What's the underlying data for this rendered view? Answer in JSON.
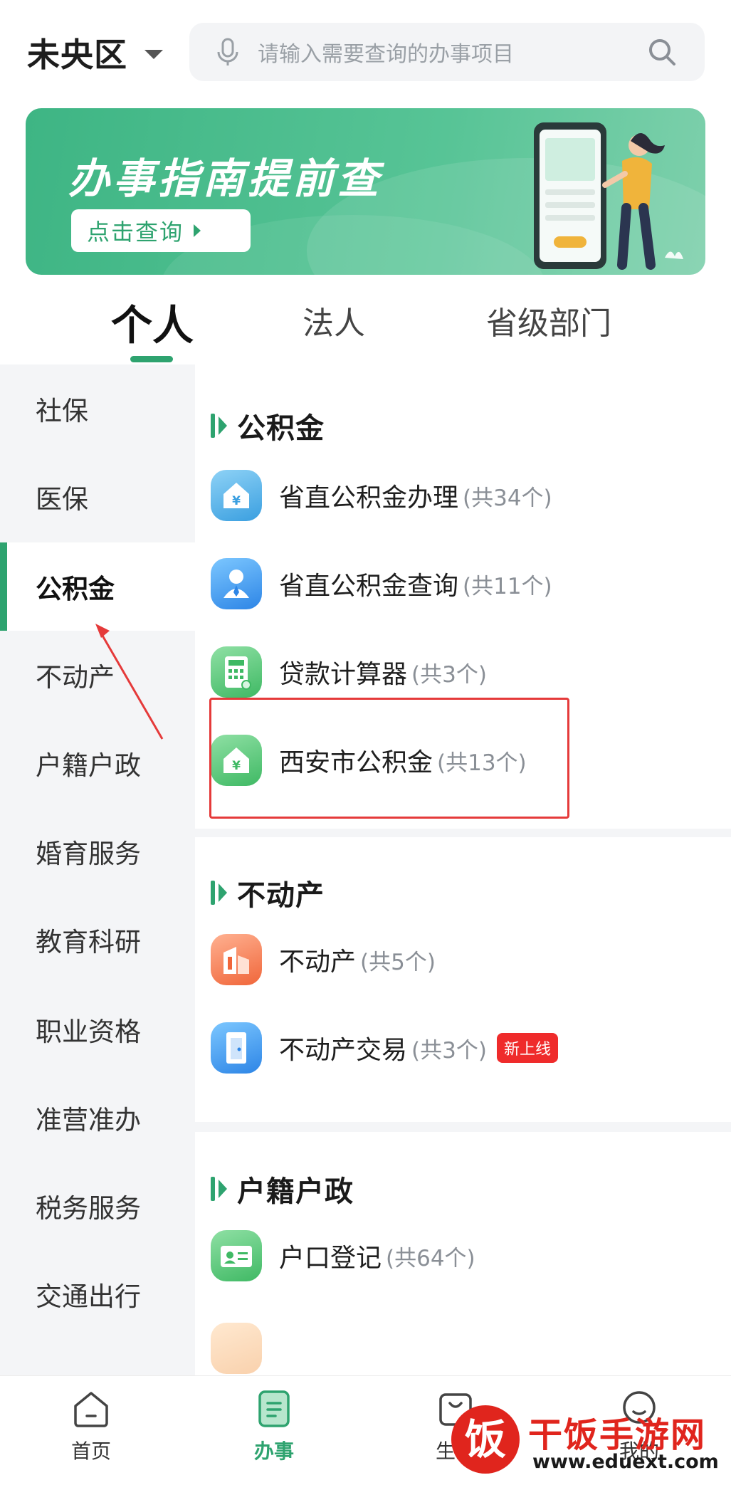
{
  "header": {
    "region": "未央区",
    "search_placeholder": "请输入需要查询的办事项目"
  },
  "banner": {
    "title": "办事指南提前查",
    "button_label": "点击查询"
  },
  "tabs": [
    {
      "label": "个人",
      "active": true
    },
    {
      "label": "法人",
      "active": false
    },
    {
      "label": "省级部门",
      "active": false
    }
  ],
  "sidebar": {
    "items": [
      {
        "label": "社保",
        "active": false
      },
      {
        "label": "医保",
        "active": false
      },
      {
        "label": "公积金",
        "active": true
      },
      {
        "label": "不动产",
        "active": false
      },
      {
        "label": "户籍户政",
        "active": false
      },
      {
        "label": "婚育服务",
        "active": false
      },
      {
        "label": "教育科研",
        "active": false
      },
      {
        "label": "职业资格",
        "active": false
      },
      {
        "label": "准营准办",
        "active": false
      },
      {
        "label": "税务服务",
        "active": false
      },
      {
        "label": "交通出行",
        "active": false
      }
    ]
  },
  "sections": [
    {
      "title": "公积金",
      "items": [
        {
          "name": "省直公积金办理",
          "count": "(共34个)",
          "icon": "house-yuan-icon"
        },
        {
          "name": "省直公积金查询",
          "count": "(共11个)",
          "icon": "person-service-icon"
        },
        {
          "name": "贷款计算器",
          "count": "(共3个)",
          "icon": "calculator-icon"
        },
        {
          "name": "西安市公积金",
          "count": "(共13个)",
          "icon": "house-yuan-icon"
        }
      ]
    },
    {
      "title": "不动产",
      "items": [
        {
          "name": "不动产",
          "count": "(共5个)",
          "icon": "building-icon"
        },
        {
          "name": "不动产交易",
          "count": "(共3个)",
          "icon": "door-icon",
          "badge": "新上线"
        }
      ]
    },
    {
      "title": "户籍户政",
      "items": [
        {
          "name": "户口登记",
          "count": "(共64个)",
          "icon": "id-card-icon"
        }
      ]
    }
  ],
  "bottom_nav": [
    {
      "label": "首页",
      "icon": "home-icon",
      "active": false
    },
    {
      "label": "办事",
      "icon": "document-icon",
      "active": true
    },
    {
      "label": "生活",
      "icon": "shopping-bag-icon",
      "active": false
    },
    {
      "label": "我的",
      "icon": "chat-bubble-icon",
      "active": false
    }
  ],
  "watermark": {
    "logo_char": "饭",
    "name": "干饭手游网",
    "url": "www.eduext.com"
  },
  "colors": {
    "accent": "#2ea36f",
    "badge": "#ef2b2b",
    "annotation": "#e53a3a"
  }
}
